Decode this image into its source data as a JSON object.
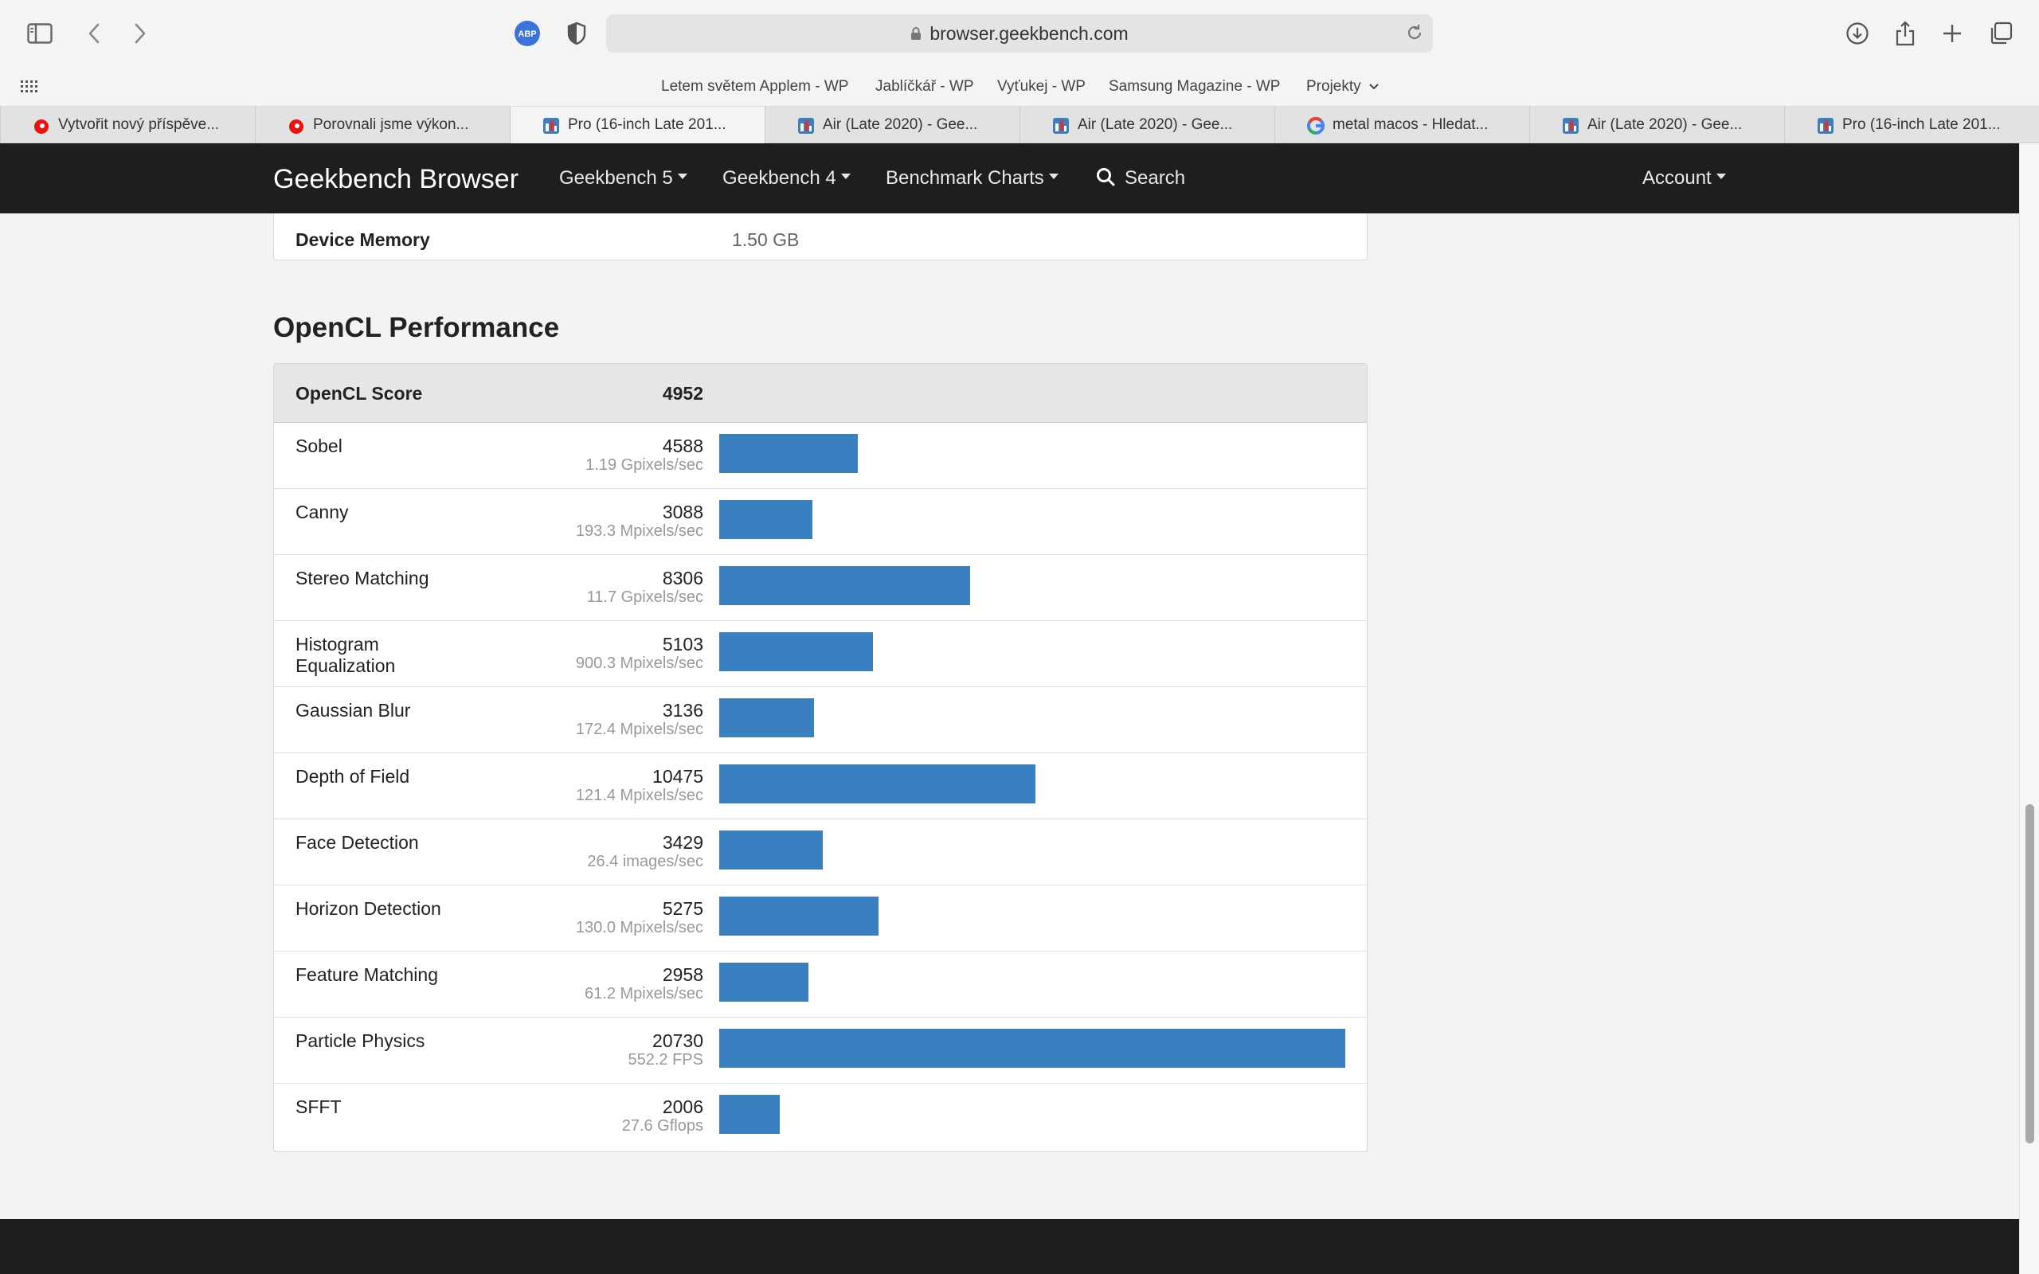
{
  "browser": {
    "url": "browser.geekbench.com",
    "bookmarks": [
      "Letem světem Applem - WP",
      "Jablíčkář - WP",
      "Vyťukej - WP",
      "Samsung Magazine - WP",
      "Projekty"
    ],
    "tabs": [
      {
        "label": "Vytvořit nový příspěve...",
        "icon": "vodafone-icon"
      },
      {
        "label": "Porovnali jsme výkon...",
        "icon": "vodafone-icon"
      },
      {
        "label": "Pro (16-inch Late 201...",
        "icon": "geekbench-icon",
        "active": true
      },
      {
        "label": "Air (Late 2020) - Gee...",
        "icon": "geekbench-icon"
      },
      {
        "label": "Air (Late 2020) - Gee...",
        "icon": "geekbench-icon"
      },
      {
        "label": "metal macos - Hledat...",
        "icon": "google-icon"
      },
      {
        "label": "Air (Late 2020) - Gee...",
        "icon": "geekbench-icon"
      },
      {
        "label": "Pro (16-inch Late 201...",
        "icon": "geekbench-icon"
      }
    ],
    "extension_badge": "ABP"
  },
  "nav": {
    "brand": "Geekbench Browser",
    "items": [
      "Geekbench 5",
      "Geekbench 4",
      "Benchmark Charts"
    ],
    "search": "Search",
    "account": "Account"
  },
  "device": {
    "memory_label": "Device Memory",
    "memory_value": "1.50 GB"
  },
  "opencl": {
    "title": "OpenCL Performance",
    "score_label": "OpenCL Score",
    "score": "4952",
    "bar_color": "#3a7fbf",
    "rows": [
      {
        "name": "Sobel",
        "score": 4588,
        "rate": "1.19 Gpixels/sec"
      },
      {
        "name": "Canny",
        "score": 3088,
        "rate": "193.3 Mpixels/sec"
      },
      {
        "name": "Stereo Matching",
        "score": 8306,
        "rate": "11.7 Gpixels/sec"
      },
      {
        "name": "Histogram Equalization",
        "score": 5103,
        "rate": "900.3 Mpixels/sec"
      },
      {
        "name": "Gaussian Blur",
        "score": 3136,
        "rate": "172.4 Mpixels/sec"
      },
      {
        "name": "Depth of Field",
        "score": 10475,
        "rate": "121.4 Mpixels/sec"
      },
      {
        "name": "Face Detection",
        "score": 3429,
        "rate": "26.4 images/sec"
      },
      {
        "name": "Horizon Detection",
        "score": 5275,
        "rate": "130.0 Mpixels/sec"
      },
      {
        "name": "Feature Matching",
        "score": 2958,
        "rate": "61.2 Mpixels/sec"
      },
      {
        "name": "Particle Physics",
        "score": 20730,
        "rate": "552.2 FPS"
      },
      {
        "name": "SFFT",
        "score": 2006,
        "rate": "27.6 Gflops"
      }
    ]
  },
  "chart_data": {
    "type": "bar",
    "categories": [
      "Sobel",
      "Canny",
      "Stereo Matching",
      "Histogram Equalization",
      "Gaussian Blur",
      "Depth of Field",
      "Face Detection",
      "Horizon Detection",
      "Feature Matching",
      "Particle Physics",
      "SFFT"
    ],
    "values": [
      4588,
      3088,
      8306,
      5103,
      3136,
      10475,
      3429,
      5275,
      2958,
      20730,
      2006
    ]
  }
}
